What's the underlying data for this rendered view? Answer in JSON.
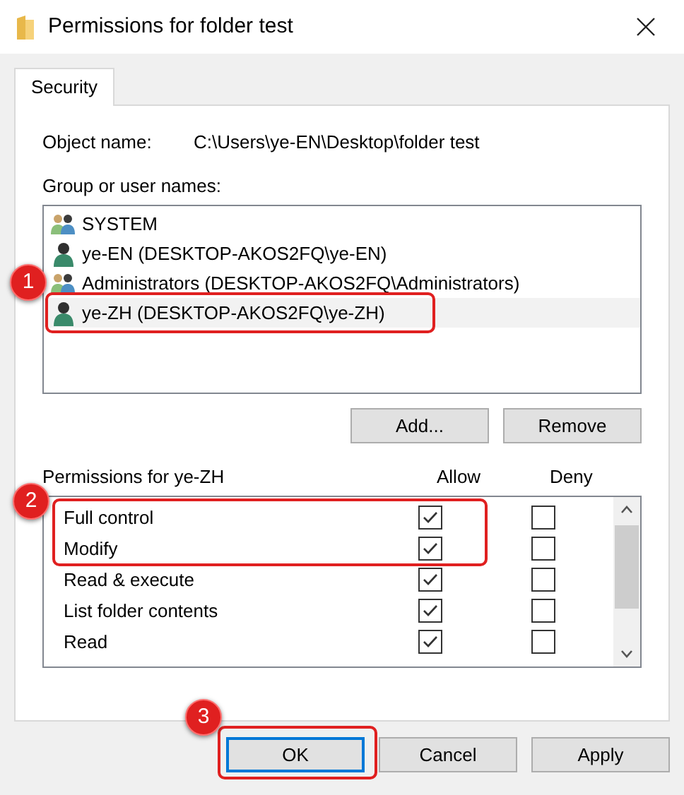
{
  "window": {
    "title": "Permissions for folder test"
  },
  "tabs": [
    {
      "label": "Security",
      "selected": true
    }
  ],
  "object_name": {
    "label": "Object name:",
    "value": "C:\\Users\\ye-EN\\Desktop\\folder test"
  },
  "users": {
    "label": "Group or user names:",
    "items": [
      {
        "name": "SYSTEM",
        "kind": "group",
        "selected": false
      },
      {
        "name": "ye-EN (DESKTOP-AKOS2FQ\\ye-EN)",
        "kind": "user",
        "selected": false
      },
      {
        "name": "Administrators (DESKTOP-AKOS2FQ\\Administrators)",
        "kind": "group",
        "selected": false
      },
      {
        "name": "ye-ZH (DESKTOP-AKOS2FQ\\ye-ZH)",
        "kind": "user",
        "selected": true
      }
    ],
    "buttons": [
      "Add...",
      "Remove"
    ]
  },
  "permissions": {
    "label": "Permissions for ye-ZH",
    "allow_header": "Allow",
    "deny_header": "Deny",
    "rows": [
      {
        "name": "Full control",
        "allow": true,
        "deny": false
      },
      {
        "name": "Modify",
        "allow": true,
        "deny": false
      },
      {
        "name": "Read & execute",
        "allow": true,
        "deny": false
      },
      {
        "name": "List folder contents",
        "allow": true,
        "deny": false
      },
      {
        "name": "Read",
        "allow": true,
        "deny": false
      }
    ]
  },
  "buttons": [
    {
      "label": "OK",
      "default": true
    },
    {
      "label": "Cancel",
      "default": false
    },
    {
      "label": "Apply",
      "default": false
    }
  ],
  "annotations": [
    "1",
    "2",
    "3"
  ]
}
